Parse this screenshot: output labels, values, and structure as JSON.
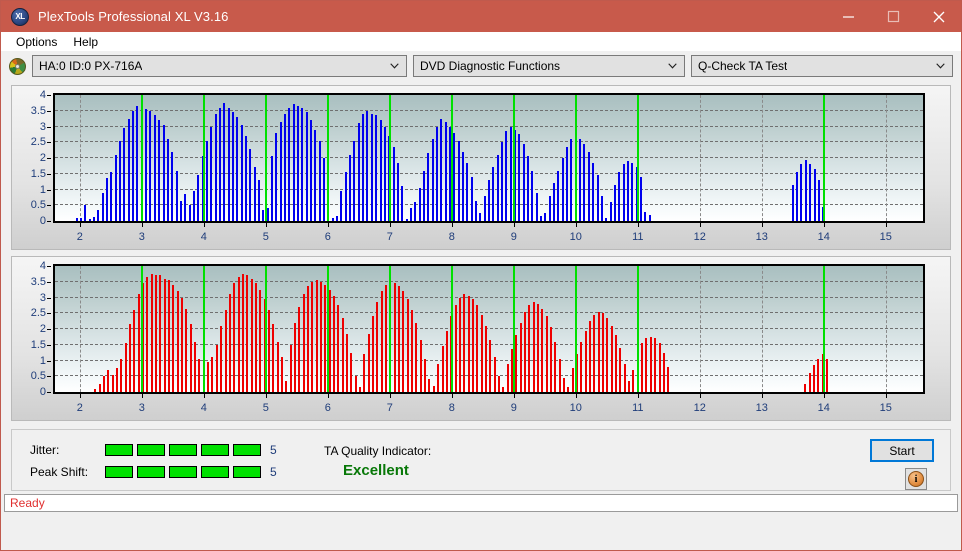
{
  "window": {
    "title": "PlexTools Professional XL V3.16",
    "icon": "disc-xl-icon",
    "minimize_label": "minimize-icon",
    "maximize_label": "maximize-icon",
    "close_label": "close-icon",
    "titlebar_color": "#c85a4b"
  },
  "menu": {
    "items": [
      {
        "label": "Options"
      },
      {
        "label": "Help"
      }
    ]
  },
  "toolbar": {
    "drive_icon": "cd-drive-icon",
    "drive_select": {
      "value": "HA:0 ID:0  PX-716A"
    },
    "function_select": {
      "value": "DVD Diagnostic Functions"
    },
    "test_select": {
      "value": "Q-Check TA Test"
    }
  },
  "chart_data": [
    {
      "id": "chart-jitter",
      "type": "bar",
      "title": "",
      "xlabel": "",
      "ylabel": "",
      "color": "#0000ee",
      "grid": true,
      "legend": "none",
      "ylim": [
        0,
        4
      ],
      "yticks": [
        0,
        0.5,
        1,
        1.5,
        2,
        2.5,
        3,
        3.5,
        4
      ],
      "ytick_labels": [
        "0",
        "0.5",
        "1",
        "1.5",
        "2",
        "2.5",
        "3",
        "3.5",
        "4"
      ],
      "xlim": [
        1.6,
        15.6
      ],
      "xticks": [
        2,
        3,
        4,
        5,
        6,
        7,
        8,
        9,
        10,
        11,
        12,
        13,
        14,
        15
      ],
      "xtick_labels": [
        "2",
        "3",
        "4",
        "5",
        "6",
        "7",
        "8",
        "9",
        "10",
        "11",
        "12",
        "13",
        "14",
        "15"
      ],
      "vertical_gridlines_at": [
        2,
        12,
        13,
        14,
        15
      ],
      "markers": [
        3,
        4,
        5,
        6,
        7,
        8,
        9,
        10,
        11,
        14
      ],
      "marker_color": "#00e000",
      "x": [
        1.95,
        2.02,
        2.09,
        2.16,
        2.23,
        2.3,
        2.37,
        2.44,
        2.51,
        2.58,
        2.65,
        2.72,
        2.79,
        2.86,
        2.93,
        3.0,
        3.07,
        3.14,
        3.21,
        3.28,
        3.35,
        3.42,
        3.49,
        3.56,
        3.63,
        3.7,
        3.77,
        3.84,
        3.91,
        3.98,
        4.05,
        4.12,
        4.19,
        4.26,
        4.33,
        4.4,
        4.47,
        4.54,
        4.61,
        4.68,
        4.75,
        4.82,
        4.89,
        4.96,
        5.03,
        5.1,
        5.17,
        5.24,
        5.31,
        5.38,
        5.45,
        5.52,
        5.59,
        5.66,
        5.73,
        5.8,
        5.87,
        5.94,
        6.01,
        6.08,
        6.15,
        6.22,
        6.29,
        6.36,
        6.43,
        6.5,
        6.57,
        6.64,
        6.71,
        6.78,
        6.85,
        6.92,
        6.99,
        7.06,
        7.13,
        7.2,
        7.27,
        7.34,
        7.41,
        7.48,
        7.55,
        7.62,
        7.69,
        7.76,
        7.83,
        7.9,
        7.97,
        8.04,
        8.11,
        8.18,
        8.25,
        8.32,
        8.39,
        8.46,
        8.53,
        8.6,
        8.67,
        8.74,
        8.81,
        8.88,
        8.95,
        9.02,
        9.09,
        9.16,
        9.23,
        9.3,
        9.37,
        9.44,
        9.51,
        9.58,
        9.65,
        9.72,
        9.79,
        9.86,
        9.93,
        10.0,
        10.07,
        10.14,
        10.21,
        10.28,
        10.35,
        10.42,
        10.49,
        10.56,
        10.63,
        10.7,
        10.77,
        10.84,
        10.91,
        10.98,
        11.05,
        11.12,
        11.19,
        13.5,
        13.57,
        13.64,
        13.71,
        13.78,
        13.85,
        13.92,
        13.99
      ],
      "values": [
        0.08,
        0.1,
        0.5,
        0.05,
        0.12,
        0.35,
        0.9,
        1.35,
        1.55,
        2.1,
        2.55,
        2.95,
        3.25,
        3.5,
        3.65,
        3.7,
        3.55,
        3.5,
        3.35,
        3.2,
        3.05,
        2.6,
        2.2,
        1.6,
        0.65,
        0.85,
        0.5,
        0.95,
        1.45,
        2.05,
        2.55,
        3.0,
        3.4,
        3.6,
        3.75,
        3.6,
        3.45,
        3.3,
        3.05,
        2.7,
        2.3,
        1.7,
        1.3,
        0.35,
        0.4,
        2.05,
        2.8,
        3.15,
        3.4,
        3.6,
        3.7,
        3.65,
        3.6,
        3.45,
        3.2,
        2.9,
        2.55,
        2.0,
        1.35,
        0.1,
        0.15,
        0.95,
        1.55,
        2.1,
        2.55,
        3.1,
        3.4,
        3.5,
        3.4,
        3.35,
        3.2,
        3.0,
        2.7,
        2.35,
        1.85,
        1.1,
        0.05,
        0.4,
        0.6,
        1.05,
        1.6,
        2.15,
        2.6,
        3.0,
        3.25,
        3.15,
        3.0,
        2.8,
        2.55,
        2.2,
        1.85,
        1.4,
        0.65,
        0.25,
        0.8,
        1.3,
        1.7,
        2.1,
        2.5,
        2.85,
        3.0,
        2.9,
        2.75,
        2.45,
        2.05,
        1.6,
        0.9,
        0.15,
        0.25,
        0.8,
        1.2,
        1.6,
        2.0,
        2.35,
        2.6,
        2.7,
        2.6,
        2.45,
        2.2,
        1.85,
        1.45,
        0.8,
        0.1,
        0.6,
        1.15,
        1.55,
        1.8,
        1.9,
        1.85,
        1.7,
        1.4,
        0.3,
        0.2,
        1.15,
        1.55,
        1.8,
        1.95,
        1.8,
        1.65,
        1.3,
        0.45
      ]
    },
    {
      "id": "chart-peak-shift",
      "type": "bar",
      "title": "",
      "xlabel": "",
      "ylabel": "",
      "color": "#ee0000",
      "grid": true,
      "legend": "none",
      "ylim": [
        0,
        4
      ],
      "yticks": [
        0,
        0.5,
        1,
        1.5,
        2,
        2.5,
        3,
        3.5,
        4
      ],
      "ytick_labels": [
        "0",
        "0.5",
        "1",
        "1.5",
        "2",
        "2.5",
        "3",
        "3.5",
        "4"
      ],
      "xlim": [
        1.6,
        15.6
      ],
      "xticks": [
        2,
        3,
        4,
        5,
        6,
        7,
        8,
        9,
        10,
        11,
        12,
        13,
        14,
        15
      ],
      "xtick_labels": [
        "2",
        "3",
        "4",
        "5",
        "6",
        "7",
        "8",
        "9",
        "10",
        "11",
        "12",
        "13",
        "14",
        "15"
      ],
      "vertical_gridlines_at": [
        2,
        12,
        13,
        14,
        15
      ],
      "markers": [
        3,
        4,
        5,
        6,
        7,
        8,
        9,
        10,
        11,
        14
      ],
      "marker_color": "#00e000",
      "x": [
        2.25,
        2.32,
        2.39,
        2.46,
        2.53,
        2.6,
        2.67,
        2.74,
        2.81,
        2.88,
        2.95,
        3.02,
        3.09,
        3.16,
        3.23,
        3.3,
        3.37,
        3.44,
        3.51,
        3.58,
        3.65,
        3.72,
        3.79,
        3.86,
        3.93,
        4.0,
        4.07,
        4.14,
        4.21,
        4.28,
        4.35,
        4.42,
        4.49,
        4.56,
        4.63,
        4.7,
        4.77,
        4.84,
        4.91,
        4.98,
        5.05,
        5.12,
        5.19,
        5.26,
        5.33,
        5.4,
        5.47,
        5.54,
        5.61,
        5.68,
        5.75,
        5.82,
        5.89,
        5.96,
        6.03,
        6.1,
        6.17,
        6.24,
        6.31,
        6.38,
        6.45,
        6.52,
        6.59,
        6.66,
        6.73,
        6.8,
        6.87,
        6.94,
        7.01,
        7.08,
        7.15,
        7.22,
        7.29,
        7.36,
        7.43,
        7.5,
        7.57,
        7.64,
        7.71,
        7.78,
        7.85,
        7.92,
        7.99,
        8.06,
        8.13,
        8.2,
        8.27,
        8.34,
        8.41,
        8.48,
        8.55,
        8.62,
        8.69,
        8.76,
        8.83,
        8.9,
        8.97,
        9.04,
        9.11,
        9.18,
        9.25,
        9.32,
        9.39,
        9.46,
        9.53,
        9.6,
        9.67,
        9.74,
        9.81,
        9.88,
        9.95,
        10.02,
        10.09,
        10.16,
        10.23,
        10.3,
        10.37,
        10.44,
        10.51,
        10.58,
        10.65,
        10.72,
        10.79,
        10.86,
        10.93,
        11.0,
        11.07,
        11.14,
        11.21,
        11.28,
        11.35,
        11.42,
        11.49,
        13.7,
        13.77,
        13.84,
        13.91,
        13.98,
        14.05
      ],
      "values": [
        0.1,
        0.25,
        0.5,
        0.7,
        0.55,
        0.75,
        1.05,
        1.55,
        2.15,
        2.6,
        3.1,
        3.45,
        3.65,
        3.75,
        3.7,
        3.7,
        3.6,
        3.55,
        3.4,
        3.2,
        3.0,
        2.65,
        2.15,
        1.6,
        1.05,
        0.35,
        0.95,
        1.1,
        1.5,
        2.1,
        2.6,
        3.1,
        3.45,
        3.65,
        3.75,
        3.7,
        3.6,
        3.45,
        3.25,
        2.95,
        2.6,
        2.15,
        1.6,
        1.1,
        0.35,
        1.5,
        2.2,
        2.7,
        3.1,
        3.35,
        3.5,
        3.55,
        3.5,
        3.4,
        3.25,
        3.05,
        2.75,
        2.35,
        1.85,
        1.25,
        0.5,
        0.15,
        1.2,
        1.85,
        2.4,
        2.85,
        3.2,
        3.4,
        3.5,
        3.45,
        3.35,
        3.2,
        2.95,
        2.6,
        2.2,
        1.65,
        1.05,
        0.4,
        0.2,
        0.9,
        1.45,
        1.95,
        2.4,
        2.75,
        3.0,
        3.1,
        3.05,
        2.95,
        2.75,
        2.45,
        2.1,
        1.65,
        1.1,
        0.5,
        0.15,
        0.9,
        1.35,
        1.8,
        2.2,
        2.55,
        2.75,
        2.85,
        2.8,
        2.65,
        2.4,
        2.05,
        1.6,
        1.05,
        0.45,
        0.15,
        0.75,
        1.2,
        1.6,
        1.95,
        2.25,
        2.45,
        2.55,
        2.5,
        2.35,
        2.1,
        1.8,
        1.4,
        0.9,
        0.35,
        0.7,
        1.2,
        1.55,
        1.7,
        1.75,
        1.7,
        1.55,
        1.25,
        0.8,
        0.25,
        0.6,
        0.85,
        1.05,
        1.2,
        1.05,
        0.8
      ]
    }
  ],
  "stats": {
    "jitter": {
      "label": "Jitter:",
      "segments_on": 5,
      "segments_total": 5,
      "value": "5"
    },
    "peak_shift": {
      "label": "Peak Shift:",
      "segments_on": 5,
      "segments_total": 5,
      "value": "5"
    },
    "meter_color": "#00e000"
  },
  "quality": {
    "label": "TA Quality Indicator:",
    "value": "Excellent",
    "color": "#087808"
  },
  "actions": {
    "start_button": "Start",
    "info_button": "i"
  },
  "status": {
    "text": "Ready",
    "color": "#e03030"
  }
}
